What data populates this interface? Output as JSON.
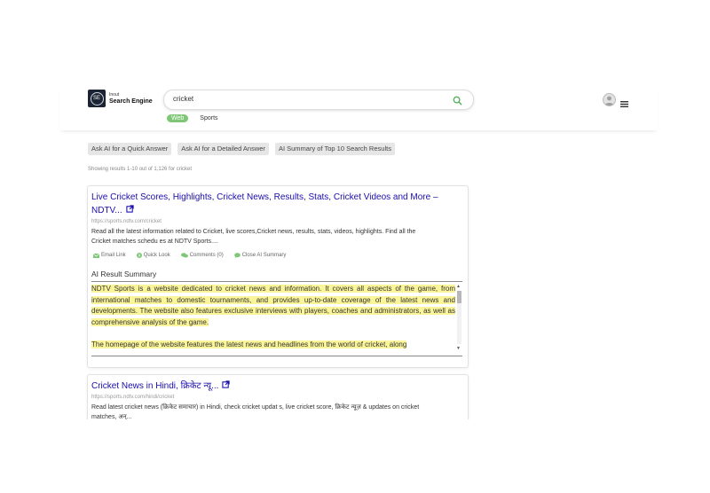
{
  "header": {
    "logo": {
      "abbr": "SE",
      "line1": "Inout",
      "line2": "Search Engine"
    },
    "search": {
      "value": "cricket"
    },
    "tabs": [
      {
        "label": "Web",
        "active": true
      },
      {
        "label": "Sports",
        "active": false
      }
    ]
  },
  "ai_buttons": [
    "Ask AI for a Quick Answer",
    "Ask AI for a Detailed Answer",
    "AI Summary of Top 10 Search Results"
  ],
  "showing": "Showing results 1-10 out of 1,126 for cricket",
  "results": [
    {
      "title_line1": "Live Cricket Scores, Highlights, Cricket News, Results, Stats, Cricket Videos and More –",
      "title_line2": "NDTV...",
      "url": "https://sports.ndtv.com/cricket",
      "snippet_line1": "Read all the latest information related to Cricket, live scores,Cricket news, results, stats, videos, highlights. Find all the",
      "snippet_line2": "Cricket matches schedu es at NDTV Sports....",
      "actions": {
        "email": "Email Link",
        "quick": "Quick Look",
        "comments": "Comments (0)",
        "close": "Close AI Summary"
      },
      "ai_summary": {
        "title": "AI Result Summary",
        "paragraph1": "NDTV Sports is a website dedicated to cricket news and information. It covers all aspects of the game, from international matches to domestic tournaments, and provides up-to-date coverage of the latest news and developments. The website also features exclusive interviews with players, coaches and administrators, as well as comprehensive analysis of the game.",
        "paragraph2": "The homepage of the website features the latest news and headlines from the world of cricket, along"
      }
    },
    {
      "title": "Cricket News in Hindi, क्रिकेट न्यू...",
      "url": "https://sports.ndtv.com/hindi/cricket",
      "snippet_line1": "Read latest cricket news (क्रिकेट समाचार) in Hindi, check cricket updat s, live cricket score, क्रिकेट न्यूज़ & updates on cricket",
      "snippet_line2": "matches, अन्..."
    }
  ],
  "colors": {
    "link": "#1a0dab",
    "highlight": "#fbf59a",
    "tab_active": "#7fc776",
    "accent": "#4caf50"
  }
}
